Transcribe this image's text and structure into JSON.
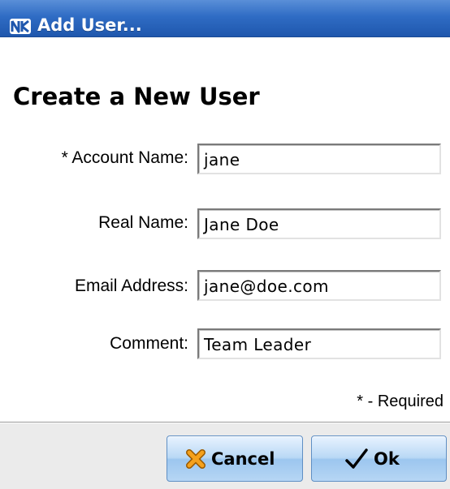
{
  "window": {
    "title": "Add User...",
    "icon": "app-logo-icon"
  },
  "heading": "Create a New User",
  "fields": [
    {
      "label": "* Account Name:",
      "value": "jane"
    },
    {
      "label": "Real Name:",
      "value": "Jane Doe"
    },
    {
      "label": "Email Address:",
      "value": "jane@doe.com"
    },
    {
      "label": "Comment:",
      "value": "Team Leader"
    }
  ],
  "required_note": "* - Required",
  "buttons": {
    "cancel": {
      "label": "Cancel",
      "icon": "x-icon"
    },
    "ok": {
      "label": "Ok",
      "icon": "checkmark-icon"
    }
  },
  "colors": {
    "titlebar": "#2f6cc4",
    "button_fill": "#b9d8f5",
    "cancel_icon": "#f5a11c"
  }
}
